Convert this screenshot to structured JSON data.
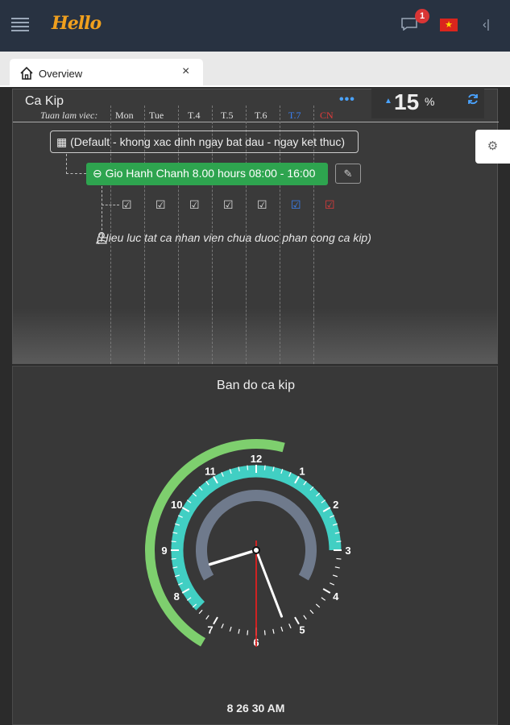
{
  "header": {
    "logo": "Hello",
    "notification_count": "1",
    "flag_symbol": "★",
    "collapse_symbol": "‹|"
  },
  "tab": {
    "label": "Overview",
    "close_symbol": "×"
  },
  "panel": {
    "title": "Ca Kip",
    "more_symbol": "•••",
    "kpi_value": "15",
    "kpi_unit": "%",
    "week_label": "Tuan lam viec:",
    "days": [
      {
        "label": "Mon",
        "color": "#e0e0e0"
      },
      {
        "label": "Tue",
        "color": "#e0e0e0"
      },
      {
        "label": "T.4",
        "color": "#e0e0e0"
      },
      {
        "label": "T.5",
        "color": "#e0e0e0"
      },
      {
        "label": "T.6",
        "color": "#e0e0e0"
      },
      {
        "label": "T.7",
        "color": "#3b82f6"
      },
      {
        "label": "CN",
        "color": "#e23b3b"
      }
    ],
    "default_label": "(Default - khong xac dinh ngay bat dau - ngay ket thuc)",
    "shift_label": "Gio Hanh Chanh 8.00 hours 08:00 - 16:00",
    "note": "(Hieu luc tat ca nhan vien chua duoc phan cong ca kip)"
  },
  "clock": {
    "title": "Ban do ca kip",
    "time": "8 26 30 AM",
    "numbers": [
      "12",
      "1",
      "2",
      "3",
      "4",
      "5",
      "6",
      "7",
      "8",
      "9",
      "10",
      "11"
    ],
    "hands": {
      "hour": 8,
      "minute": 26,
      "second": 30
    },
    "outer_arc_hours": [
      7,
      12.5
    ],
    "teal_arc_hours": [
      7.5,
      15
    ],
    "inner_arc_hours": [
      8,
      16
    ],
    "colors": {
      "outer": "#7ecf6e",
      "teal": "#41cfc3",
      "inner": "#6f7a8c",
      "second_hand": "#e02020"
    }
  }
}
